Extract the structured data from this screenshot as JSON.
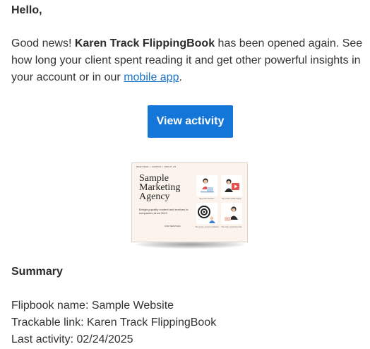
{
  "greeting": "Hello,",
  "message": {
    "intro": "Good news! ",
    "flipbook_title": "Karen Track FlippingBook",
    "text_after_title": " has been opened again. See how long your client spent reading it and get other powerful insights in your account or in our ",
    "link_label": "mobile app",
    "text_end": "."
  },
  "cta": {
    "label": "View activity",
    "color": "#1476d9"
  },
  "thumbnail": {
    "nav": "NEW PAGE   >   CAMPUS   >   ABOUT US",
    "title": "Sample\nMarketing\nAgency",
    "tagline": "Bringing quality content and services to companies since 2010",
    "button": "OUR SERVICES",
    "cards": [
      {
        "caption": "Best web solutions",
        "icon": "person-laptop-illustration"
      },
      {
        "caption": "We create quality videos",
        "icon": "person-video-illustration"
      },
      {
        "caption": "We ensure your ad marketing",
        "icon": "target-illustration"
      },
      {
        "caption": "We make convincing copy",
        "icon": "person-writing-illustration"
      }
    ]
  },
  "summary": {
    "title": "Summary",
    "rows": [
      {
        "label": "Flipbook name: ",
        "value": "Sample Website"
      },
      {
        "label": "Trackable link: ",
        "value": "Karen Track FlippingBook"
      },
      {
        "label": "Last activity: ",
        "value": "02/24/2025"
      }
    ]
  }
}
